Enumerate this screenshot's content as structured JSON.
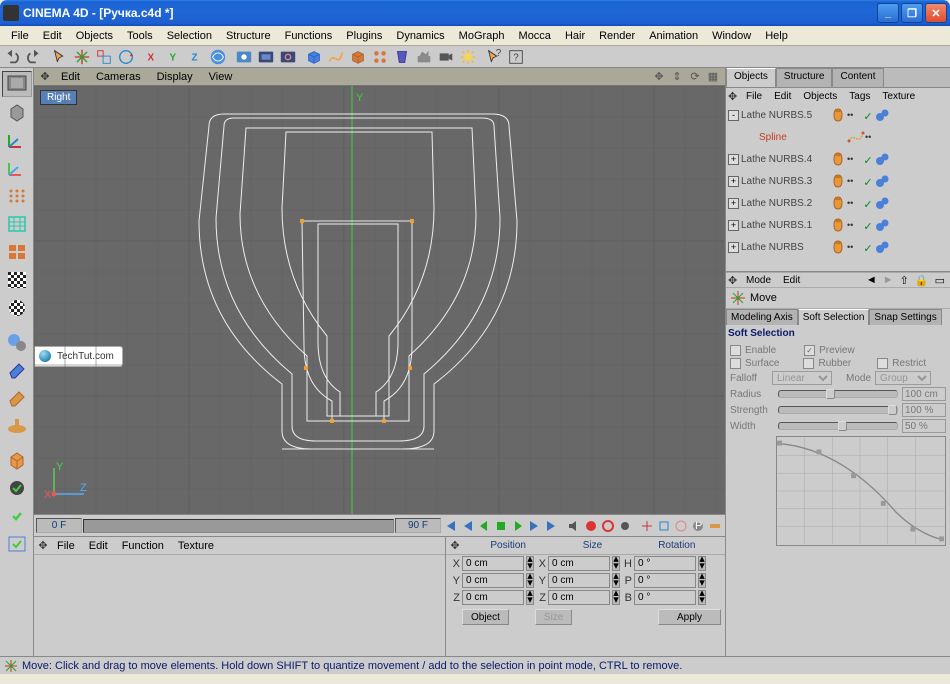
{
  "window": {
    "title": "CINEMA 4D - [Ручка.c4d *]"
  },
  "menu": [
    "File",
    "Edit",
    "Objects",
    "Tools",
    "Selection",
    "Structure",
    "Functions",
    "Plugins",
    "Dynamics",
    "MoGraph",
    "Mocca",
    "Hair",
    "Render",
    "Animation",
    "Window",
    "Help"
  ],
  "viewport": {
    "menu": [
      "Edit",
      "Cameras",
      "Display",
      "View"
    ],
    "label": "Right",
    "axes": {
      "v": "Y",
      "h": "Z"
    },
    "watermark": "TechTut.com"
  },
  "timeline": {
    "start": "0 F",
    "end": "90 F"
  },
  "material_menu": [
    "File",
    "Edit",
    "Function",
    "Texture"
  ],
  "coords": {
    "cols": [
      "Position",
      "Size",
      "Rotation"
    ],
    "rows": [
      {
        "axis": "X",
        "pos": "0 cm",
        "size": "0 cm",
        "rlbl": "H",
        "rot": "0 °"
      },
      {
        "axis": "Y",
        "pos": "0 cm",
        "size": "0 cm",
        "rlbl": "P",
        "rot": "0 °"
      },
      {
        "axis": "Z",
        "pos": "0 cm",
        "size": "0 cm",
        "rlbl": "B",
        "rot": "0 °"
      }
    ],
    "obj_btn": "Object",
    "size_btn": "Size",
    "apply": "Apply"
  },
  "obj_panel": {
    "tabs": [
      "Objects",
      "Structure",
      "Content"
    ],
    "menu": [
      "File",
      "Edit",
      "Objects",
      "Tags",
      "Texture"
    ],
    "tree": [
      {
        "exp": "-",
        "name": "Lathe NURBS.5",
        "type": "lathe",
        "sel": false,
        "child": false
      },
      {
        "exp": "",
        "name": "Spline",
        "type": "spline",
        "sel": true,
        "child": true
      },
      {
        "exp": "+",
        "name": "Lathe NURBS.4",
        "type": "lathe",
        "sel": false,
        "child": false
      },
      {
        "exp": "+",
        "name": "Lathe NURBS.3",
        "type": "lathe",
        "sel": false,
        "child": false
      },
      {
        "exp": "+",
        "name": "Lathe NURBS.2",
        "type": "lathe",
        "sel": false,
        "child": false
      },
      {
        "exp": "+",
        "name": "Lathe NURBS.1",
        "type": "lathe",
        "sel": false,
        "child": false
      },
      {
        "exp": "+",
        "name": "Lathe NURBS",
        "type": "lathe",
        "sel": false,
        "child": false
      }
    ]
  },
  "attr": {
    "menu": [
      "Mode",
      "Edit"
    ],
    "tool": "Move",
    "tabs": [
      "Modeling Axis",
      "Soft Selection",
      "Snap Settings"
    ],
    "active_tab": 1,
    "heading": "Soft Selection",
    "enable": "Enable",
    "preview": "Preview",
    "surface": "Surface",
    "rubber": "Rubber",
    "restrict": "Restrict",
    "falloff_lbl": "Falloff",
    "falloff_val": "Linear",
    "mode_lbl": "Mode",
    "mode_val": "Group",
    "radius_lbl": "Radius",
    "radius_val": "100 cm",
    "strength_lbl": "Strength",
    "strength_val": "100 %",
    "width_lbl": "Width",
    "width_val": "50 %"
  },
  "status": "Move: Click and drag to move elements. Hold down SHIFT to quantize movement / add to the selection in point mode, CTRL to remove."
}
